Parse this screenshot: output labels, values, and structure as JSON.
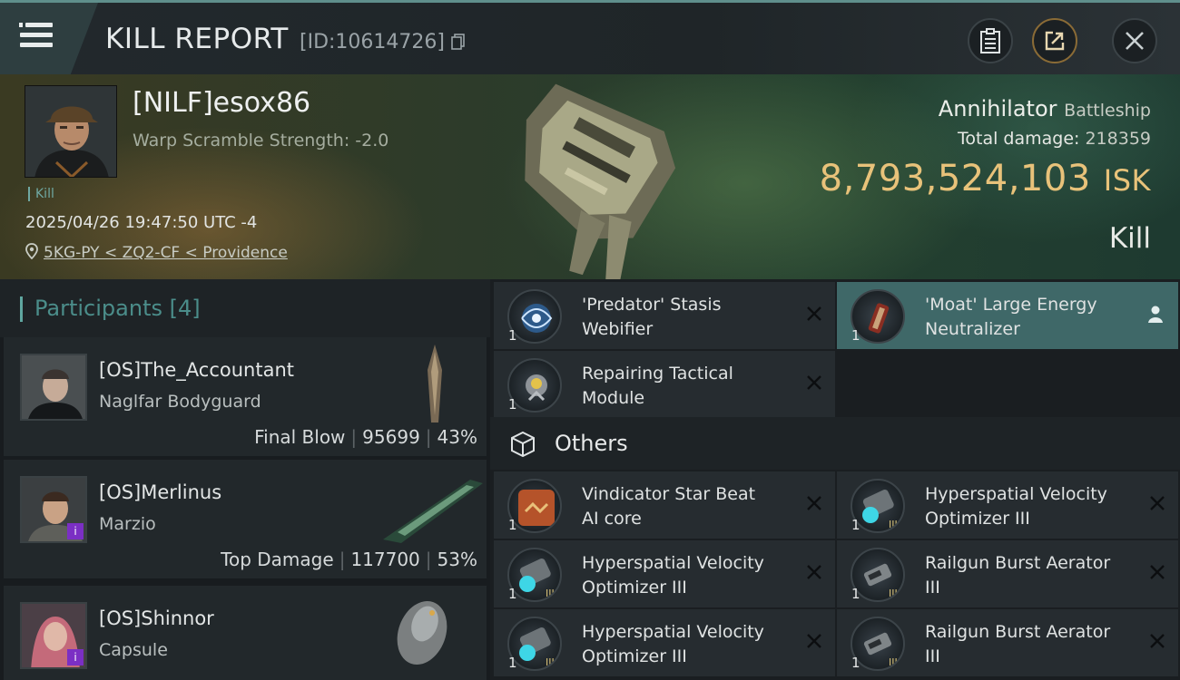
{
  "header": {
    "title": "KILL REPORT",
    "report_id": "[ID:10614726]",
    "icons": [
      "menu-icon",
      "copy-icon",
      "clipboard-icon",
      "share-icon",
      "close-icon"
    ]
  },
  "victim": {
    "name": "[NILF]esox86",
    "warp_scramble": "Warp Scramble Strength: -2.0",
    "kill_tag": "Kill",
    "datetime": "2025/04/26 19:47:50 UTC -4",
    "location": "5KG-PY < ZQ2-CF < Providence",
    "ship": "Annihilator",
    "ship_class": "Battleship",
    "total_damage_label": "Total damage:",
    "total_damage": "218359",
    "isk_value": "8,793,524,103",
    "isk_unit": "ISK",
    "result": "Kill"
  },
  "participants": {
    "header": "Participants",
    "count": "[4]",
    "items": [
      {
        "name": "[OS]The_Accountant",
        "ship": "Naglfar Bodyguard",
        "role": "Final Blow",
        "damage": "95699",
        "percent": "43%"
      },
      {
        "name": "[OS]Merlinus",
        "ship": "Marzio",
        "role": "Top Damage",
        "damage": "117700",
        "percent": "53%"
      },
      {
        "name": "[OS]Shinnor",
        "ship": "Capsule"
      }
    ]
  },
  "modules": {
    "fitted": [
      {
        "qty": "1",
        "line1": "'Predator' Stasis",
        "line2": "Webifier"
      },
      {
        "qty": "1",
        "line1": "'Moat' Large Energy",
        "line2": "Neutralizer"
      },
      {
        "qty": "1",
        "line1": "Repairing Tactical",
        "line2": "Module"
      }
    ],
    "others_label": "Others",
    "others": [
      {
        "qty": "1",
        "line1": "Vindicator Star Beat",
        "line2": "AI core"
      },
      {
        "qty": "1",
        "line1": "Hyperspatial Velocity",
        "line2": "Optimizer III"
      },
      {
        "qty": "1",
        "line1": "Hyperspatial Velocity",
        "line2": "Optimizer III"
      },
      {
        "qty": "1",
        "line1": "Railgun Burst Aerator",
        "line2": "III"
      },
      {
        "qty": "1",
        "line1": "Hyperspatial Velocity",
        "line2": "Optimizer III"
      },
      {
        "qty": "1",
        "line1": "Railgun Burst Aerator",
        "line2": "III"
      }
    ]
  },
  "colors": {
    "accent": "#5fa6a0",
    "isk": "#e8c27a",
    "highlight_row": "#3f6868"
  }
}
